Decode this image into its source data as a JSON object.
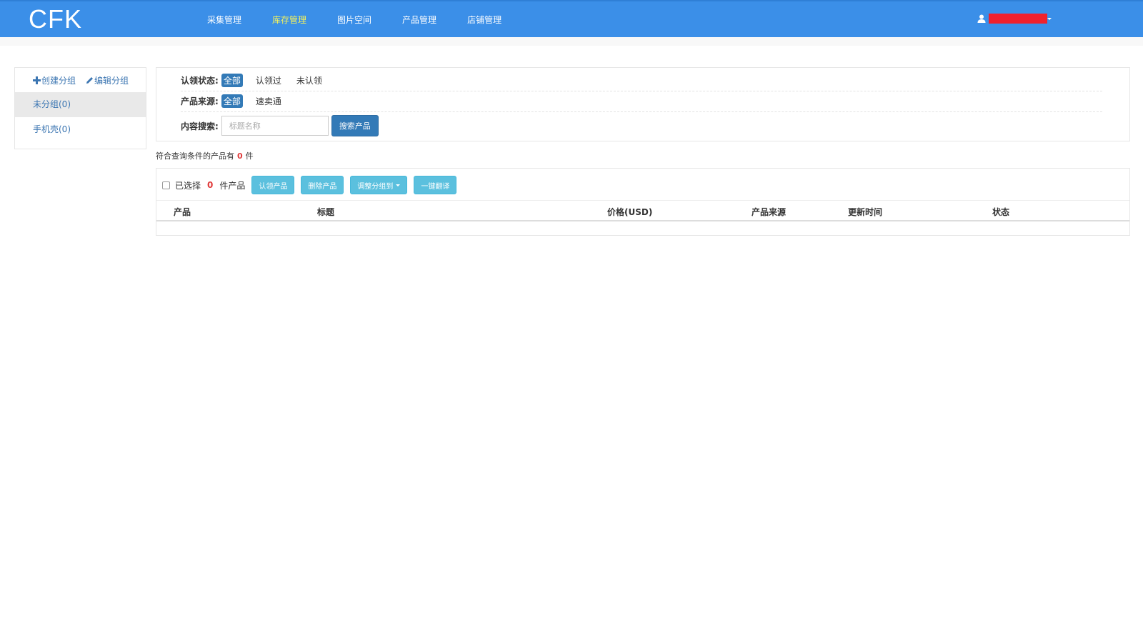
{
  "header": {
    "logo": "CFK",
    "nav": [
      {
        "label": "采集管理",
        "active": false
      },
      {
        "label": "库存管理",
        "active": true
      },
      {
        "label": "图片空间",
        "active": false
      },
      {
        "label": "产品管理",
        "active": false
      },
      {
        "label": "店铺管理",
        "active": false
      }
    ],
    "colors": {
      "bar": "#3b8fe8",
      "active_nav": "#f7f35a",
      "redacted_user": "#f0212d"
    }
  },
  "sidebar": {
    "create_group": "创建分组",
    "edit_group": "编辑分组",
    "groups": [
      {
        "label": "未分组(0)",
        "selected": true
      },
      {
        "label": "手机壳(0)",
        "selected": false
      }
    ]
  },
  "filters": {
    "claim_status": {
      "label": "认领状态:",
      "options": [
        "全部",
        "认领过",
        "未认领"
      ],
      "selected": "全部"
    },
    "source": {
      "label": "产品来源:",
      "options": [
        "全部",
        "速卖通"
      ],
      "selected": "全部"
    },
    "search": {
      "label": "内容搜索:",
      "placeholder": "标题名称",
      "value": "",
      "button": "搜索产品"
    }
  },
  "result": {
    "prefix": "符合查询条件的产品有",
    "count": "0",
    "suffix": "件"
  },
  "toolbar": {
    "selected_prefix": "已选择",
    "selected_count": "0",
    "selected_suffix": "件产品",
    "buttons": {
      "claim": "认领产品",
      "delete": "删除产品",
      "move_group": "调整分组到",
      "translate": "一键翻译"
    }
  },
  "table": {
    "columns": [
      "产品",
      "标题",
      "价格(USD)",
      "产品来源",
      "更新时间",
      "状态"
    ],
    "rows": []
  }
}
